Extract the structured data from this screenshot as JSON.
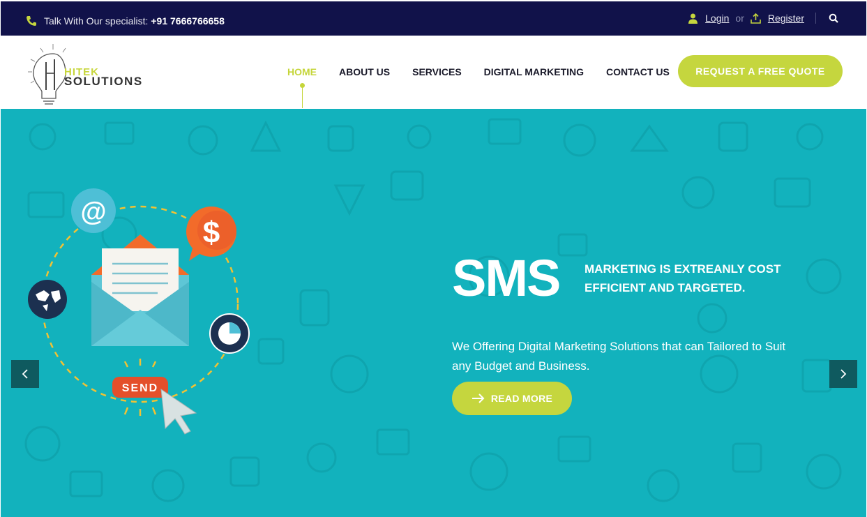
{
  "topbar": {
    "specialist_label": "Talk With Our specialist:",
    "phone": "+91 7666766658",
    "login": "Login",
    "or": "or",
    "register": "Register"
  },
  "logo": {
    "line1": "HITEK",
    "line2": "SOLUTIONS"
  },
  "nav": {
    "items": [
      {
        "label": "HOME",
        "active": true
      },
      {
        "label": "ABOUT US"
      },
      {
        "label": "SERVICES"
      },
      {
        "label": "DIGITAL MARKETING"
      },
      {
        "label": "CONTACT US"
      }
    ],
    "quote_button": "REQUEST A FREE QUOTE"
  },
  "hero": {
    "title": "SMS",
    "tagline": "MARKETING IS EXTREANLY COST EFFICIENT AND TARGETED.",
    "description": "We Offering Digital Marketing Solutions that can Tailored to Suit any Budget and Business.",
    "button": "READ MORE",
    "illustration_button": "SEND",
    "at_symbol": "@",
    "dollar_symbol": "$"
  },
  "colors": {
    "topbar": "#11124a",
    "accent": "#c5d63e",
    "hero_bg": "#12b2bd",
    "arrow_bg": "#0f5a5f"
  },
  "icons": [
    "phone-icon",
    "user-icon",
    "upload-icon",
    "search-icon",
    "chevron-left-icon",
    "chevron-right-icon",
    "arrow-right-icon"
  ]
}
